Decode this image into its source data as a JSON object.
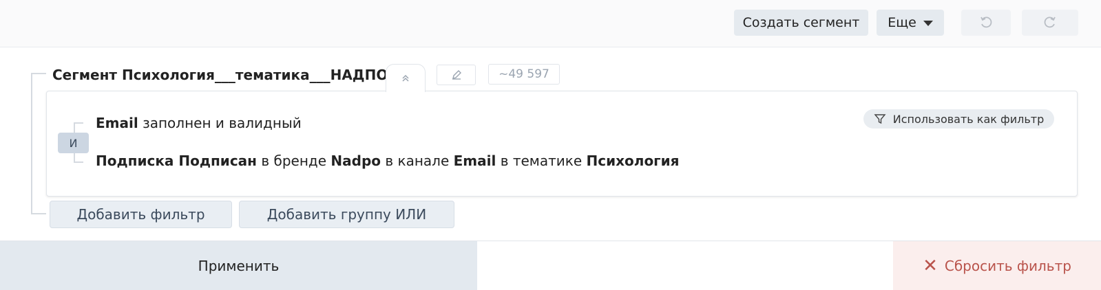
{
  "toolbar": {
    "create_segment": "Создать сегмент",
    "more": "Еще",
    "undo_icon": "undo-icon",
    "redo_icon": "redo-icon"
  },
  "segment": {
    "title": "Сегмент Психология___тематика___НАДПО",
    "collapse_icon": "chevron-double-up-icon",
    "edit_icon": "pencil-icon",
    "count": "~49 597",
    "operator": "И",
    "use_as_filter": "Использовать как фильтр",
    "conditions": [
      [
        {
          "text": "Email",
          "bold": true
        },
        {
          "text": " заполнен и валидный",
          "bold": false
        }
      ],
      [
        {
          "text": "Подписка Подписан",
          "bold": true
        },
        {
          "text": " в бренде ",
          "bold": false
        },
        {
          "text": "Nadpo",
          "bold": true
        },
        {
          "text": " в канале ",
          "bold": false
        },
        {
          "text": "Email",
          "bold": true
        },
        {
          "text": " в тематике ",
          "bold": false
        },
        {
          "text": "Психология",
          "bold": true
        }
      ]
    ],
    "add_filter": "Добавить фильтр",
    "add_or_group": "Добавить группу ИЛИ"
  },
  "footer": {
    "apply": "Применить",
    "reset": "Сбросить фильтр",
    "reset_icon": "close-icon"
  },
  "colors": {
    "button_bg": "#e5eaef",
    "badge_bg": "#ccd6e2",
    "reset_text": "#b9534b",
    "reset_bg": "#fbeeed"
  }
}
